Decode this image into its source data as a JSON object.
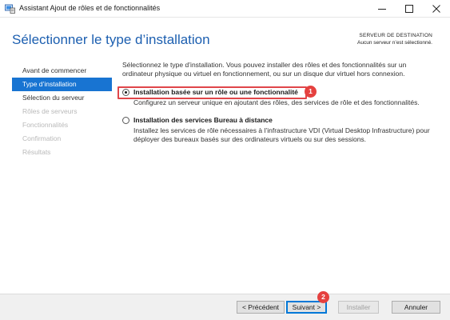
{
  "window": {
    "title": "Assistant Ajout de rôles et de fonctionnalités",
    "icon": "server-manager-icon"
  },
  "header": {
    "page_title": "Sélectionner le type d’installation",
    "destination_label": "SERVEUR DE DESTINATION",
    "destination_value": "Aucun serveur n’est sélectionné."
  },
  "sidebar": {
    "items": [
      {
        "label": "Avant de commencer",
        "state": "normal"
      },
      {
        "label": "Type d’installation",
        "state": "active"
      },
      {
        "label": "Sélection du serveur",
        "state": "normal"
      },
      {
        "label": "Rôles de serveurs",
        "state": "disabled"
      },
      {
        "label": "Fonctionnalités",
        "state": "disabled"
      },
      {
        "label": "Confirmation",
        "state": "disabled"
      },
      {
        "label": "Résultats",
        "state": "disabled"
      }
    ]
  },
  "main": {
    "intro": "Sélectionnez le type d’installation. Vous pouvez installer des rôles et des fonctionnalités sur un ordinateur physique ou virtuel en fonctionnement, ou sur un disque dur virtuel hors connexion.",
    "options": [
      {
        "label": "Installation basée sur un rôle ou une fonctionnalité",
        "description": "Configurez un serveur unique en ajoutant des rôles, des services de rôle et des fonctionnalités.",
        "selected": true
      },
      {
        "label": "Installation des services Bureau à distance",
        "description": "Installez les services de rôle nécessaires à l’infrastructure VDI (Virtual Desktop Infrastructure) pour déployer des bureaux basés sur des ordinateurs virtuels ou sur des sessions.",
        "selected": false
      }
    ]
  },
  "annotations": {
    "badge1": "1",
    "badge2": "2",
    "color": "#e5413f"
  },
  "footer": {
    "prev_label": "< Précédent",
    "next_label": "Suivant >",
    "install_label": "Installer",
    "cancel_label": "Annuler"
  },
  "colors": {
    "accent": "#1874d2",
    "title": "#1c5fb0"
  }
}
